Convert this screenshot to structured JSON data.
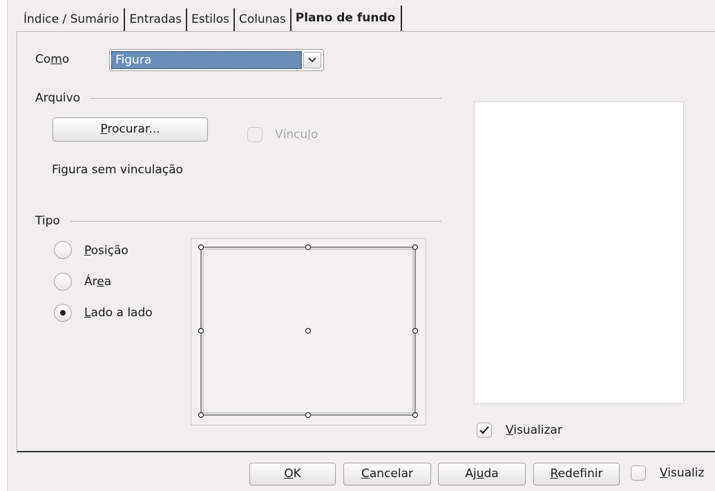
{
  "tabs": [
    {
      "label": "Índice / Sumário",
      "active": false
    },
    {
      "label": "Entradas",
      "active": false
    },
    {
      "label": "Estilos",
      "active": false
    },
    {
      "label": "Colunas",
      "active": false
    },
    {
      "label": "Plano de fundo",
      "active": true
    }
  ],
  "como": {
    "label_pre": "Co",
    "label_mnemonic": "m",
    "label_post": "o",
    "selected_value": "Figura",
    "arrow_icon": "chevron-down-icon"
  },
  "arquivo": {
    "section_label": "Arquivo",
    "browse_mnemonic": "P",
    "browse_rest": "rocurar...",
    "link_pre": "Víncu",
    "link_mnemonic": "l",
    "link_post": "o",
    "link_checked": false,
    "status_text": "Figura sem vinculação"
  },
  "tipo": {
    "section_label": "Tipo",
    "options": [
      {
        "pre": "",
        "mnemonic": "P",
        "post": "osição",
        "selected": false
      },
      {
        "pre": "Ár",
        "mnemonic": "e",
        "post": "a",
        "selected": false
      },
      {
        "pre": "",
        "mnemonic": "L",
        "post": "ado a lado",
        "selected": true
      }
    ]
  },
  "preview": {
    "checkbox_mnemonic": "V",
    "checkbox_rest": "isualizar",
    "checked": true
  },
  "footer": {
    "ok_mnemonic": "O",
    "ok_rest": "K",
    "cancel_mnemonic": "C",
    "cancel_rest": "ancelar",
    "help_pre": "Aj",
    "help_mnemonic": "u",
    "help_post": "da",
    "reset_mnemonic": "R",
    "reset_rest": "edefinir",
    "preview_mnemonic": "V",
    "preview_rest": "isualiz",
    "preview_checked": false
  },
  "colors": {
    "selection": "#6b8db9",
    "window_bg": "#f0efee"
  }
}
